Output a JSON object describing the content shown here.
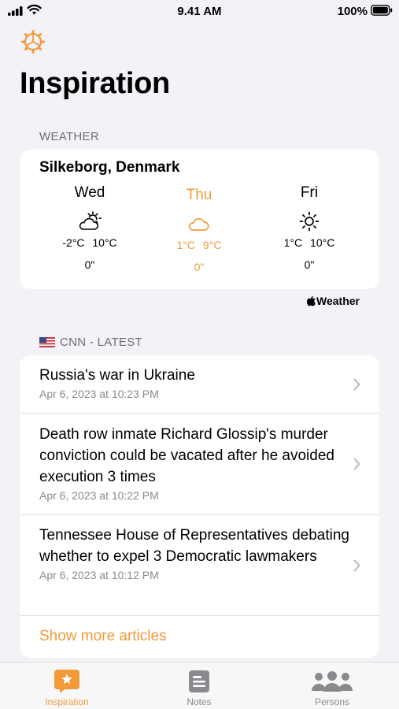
{
  "status_bar": {
    "time": "9.41 AM",
    "battery": "100%"
  },
  "header": {
    "title": "Inspiration"
  },
  "weather": {
    "section_label": "WEATHER",
    "location": "Silkeborg, Denmark",
    "days": [
      {
        "name": "Wed",
        "icon": "partly-sunny-icon",
        "temps": "-2°C 10°C",
        "precip": "0\""
      },
      {
        "name": "Thu",
        "icon": "cloud-icon",
        "temps": "1°C 9°C",
        "precip": "0\""
      },
      {
        "name": "Fri",
        "icon": "sun-icon",
        "temps": "1°C 10°C",
        "precip": "0\""
      }
    ],
    "attribution": "Weather"
  },
  "news": {
    "section_label": "CNN - LATEST",
    "articles": [
      {
        "title": "Russia's war in Ukraine",
        "date": "Apr 6, 2023 at 10:23 PM"
      },
      {
        "title": "Death row inmate Richard Glossip's murder conviction could be vacated after he avoided execution 3 times",
        "date": "Apr 6, 2023 at 10:22 PM"
      },
      {
        "title": "Tennessee House of Representatives debating whether to expel 3 Democratic lawmakers",
        "date": "Apr 6, 2023 at 10:12 PM"
      }
    ],
    "show_more": "Show more articles"
  },
  "tabs": [
    {
      "label": "Inspiration",
      "active": true
    },
    {
      "label": "Notes",
      "active": false
    },
    {
      "label": "Persons",
      "active": false
    }
  ],
  "colors": {
    "accent": "#f29a3a",
    "background": "#f2f2f7",
    "secondary_text": "#8a8a8e"
  }
}
